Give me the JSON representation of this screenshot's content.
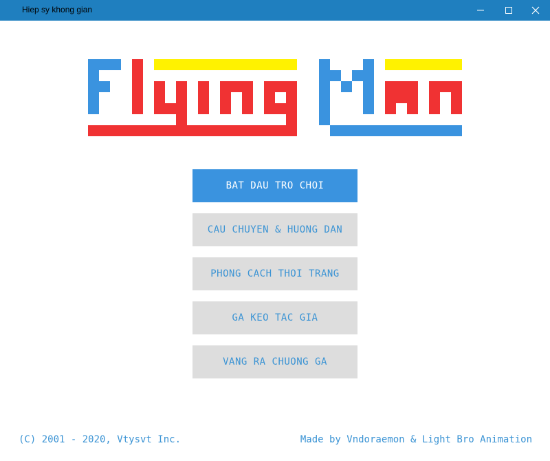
{
  "window": {
    "title": "Hiep sy khong gian"
  },
  "logo": {
    "text": "Flying Man",
    "colors": {
      "blue": "#3a93df",
      "red": "#f03233",
      "yellow": "#fff200"
    }
  },
  "menu": {
    "items": [
      {
        "label": "BAT DAU TRO CHOI"
      },
      {
        "label": "CAU CHUYEN & HUONG DAN"
      },
      {
        "label": "PHONG CACH THOI TRANG"
      },
      {
        "label": "GA KEO TAC GIA"
      },
      {
        "label": "VANG RA CHUONG GA"
      }
    ]
  },
  "footer": {
    "copyright": "(C) 2001 - 2020, Vtysvt Inc.",
    "credits": "Made by Vndoraemon & Light Bro Animation"
  },
  "colors": {
    "titlebar": "#1f7fbf",
    "accent": "#3a93df",
    "button_bg": "#dddddd",
    "text_blue": "#3a93d4"
  }
}
